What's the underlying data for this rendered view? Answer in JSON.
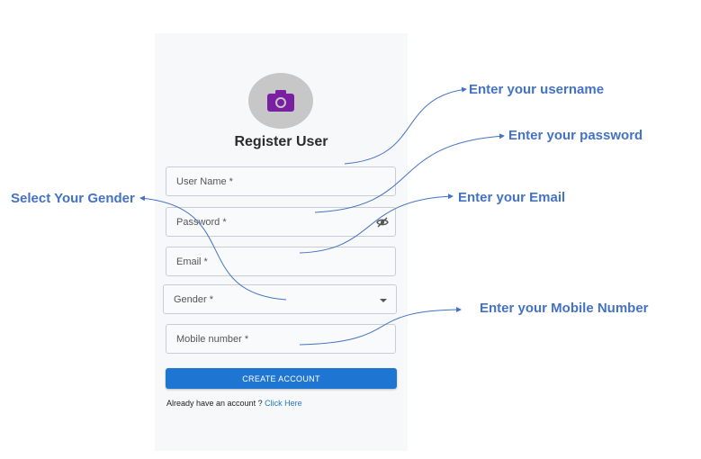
{
  "form": {
    "title": "Register User",
    "fields": [
      {
        "label": "User Name *"
      },
      {
        "label": "Password *"
      },
      {
        "label": "Email *"
      },
      {
        "label": "Gender *"
      },
      {
        "label": "Mobile number *"
      }
    ],
    "submit_label": "CREATE ACCOUNT",
    "already_text": "Already have an account ?",
    "click_here": "Click Here"
  },
  "annotations": {
    "username": "Enter your username",
    "password": "Enter your password",
    "email": "Enter your Email",
    "gender": "Select Your Gender",
    "mobile": "Enter your Mobile Number"
  },
  "colors": {
    "accent": "#1f76d2",
    "annotation": "#4472c4",
    "camera": "#7b1fa2"
  }
}
